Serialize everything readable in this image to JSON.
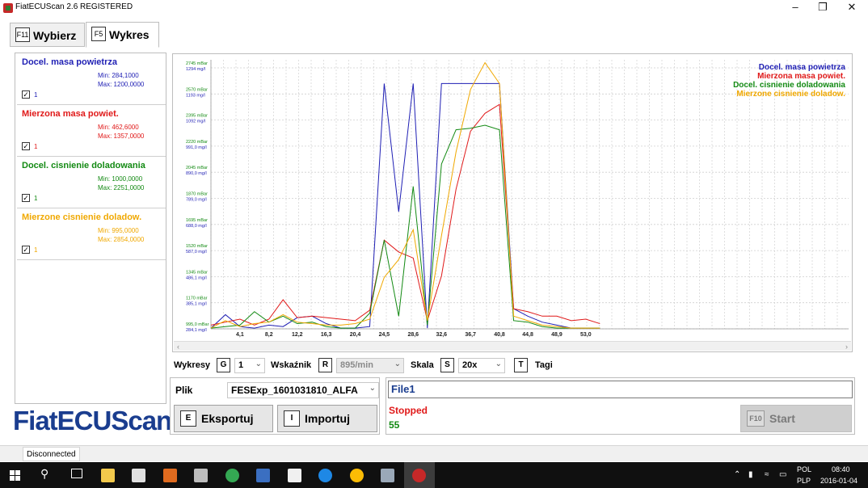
{
  "window": {
    "title": "FiatECUScan 2.6 REGISTERED"
  },
  "tabs": [
    {
      "key": "F11",
      "label": "Wybierz"
    },
    {
      "key": "F5",
      "label": "Wykres"
    }
  ],
  "series": [
    {
      "name": "Docel. masa powietrza",
      "min": "Min: 284,1000",
      "max": "Max: 1200,0000",
      "checked": "1",
      "color": "#1f1fb4"
    },
    {
      "name": "Mierzona masa powiet.",
      "min": "Min: 462,6000",
      "max": "Max: 1357,0000",
      "checked": "1",
      "color": "#e01919"
    },
    {
      "name": "Docel. cisnienie doladowania",
      "min": "Min: 1000,0000",
      "max": "Max: 2251,0000",
      "checked": "1",
      "color": "#138a13"
    },
    {
      "name": "Mierzone cisnienie doladow.",
      "min": "Min: 995,0000",
      "max": "Max: 2854,0000",
      "checked": "1",
      "color": "#f0a800"
    }
  ],
  "logo": "FiatECUScan",
  "chart_data": {
    "type": "line",
    "x": [
      0,
      2.05,
      4.1,
      6.15,
      8.2,
      10.2,
      12.2,
      14.3,
      16.3,
      18.35,
      20.4,
      22.45,
      24.5,
      26.55,
      28.6,
      30.6,
      32.6,
      34.65,
      36.7,
      38.75,
      40.8,
      42.8,
      44.8,
      46.85,
      48.9,
      50.95,
      53.0,
      55.0
    ],
    "x_ticks": [
      "4,1",
      "8,2",
      "12,2",
      "16,3",
      "20,4",
      "24,5",
      "28,6",
      "32,6",
      "36,7",
      "40,8",
      "44,8",
      "48,9",
      "53,0"
    ],
    "y_ticks": [
      {
        "bar": "995,0 mBar",
        "mg": "284,1 mg/l"
      },
      {
        "bar": "1170 mBar",
        "mg": "385,1 mg/l"
      },
      {
        "bar": "1345 mBar",
        "mg": "486,1 mg/l"
      },
      {
        "bar": "1520 mBar",
        "mg": "587,0 mg/l"
      },
      {
        "bar": "1695 mBar",
        "mg": "688,0 mg/l"
      },
      {
        "bar": "1870 mBar",
        "mg": "789,0 mg/l"
      },
      {
        "bar": "2045 mBar",
        "mg": "890,0 mg/l"
      },
      {
        "bar": "2220 mBar",
        "mg": "991,0 mg/l"
      },
      {
        "bar": "2395 mBar",
        "mg": "1092 mg/l"
      },
      {
        "bar": "2570 mBar",
        "mg": "1193 mg/l"
      },
      {
        "bar": "2745 mBar",
        "mg": "1294 mg/l"
      }
    ],
    "ylim": [
      995,
      2745
    ],
    "grid": true,
    "legend": "top-right",
    "series": [
      {
        "name": "Docel. masa powietrza",
        "color": "#1f1fb4",
        "values": [
          1000,
          1090,
          1010,
          1000,
          1020,
          1010,
          1070,
          1080,
          1030,
          1000,
          1000,
          1010,
          2640,
          1780,
          2640,
          1000,
          2640,
          2640,
          2640,
          2640,
          2640,
          1130,
          1080,
          1040,
          1020,
          1000,
          1000,
          1000
        ]
      },
      {
        "name": "Mierzona masa powiet.",
        "color": "#e01919",
        "values": [
          1020,
          1040,
          1060,
          1020,
          1060,
          1190,
          1070,
          1080,
          1070,
          1060,
          1050,
          1120,
          1590,
          1510,
          1470,
          1050,
          1350,
          1930,
          2320,
          2440,
          2500,
          1130,
          1110,
          1080,
          1080,
          1050,
          1060,
          1030
        ]
      },
      {
        "name": "Docel. cisnienie doladowania",
        "color": "#138a13",
        "values": [
          1000,
          1010,
          1020,
          1110,
          1040,
          1080,
          1030,
          1040,
          1010,
          1000,
          1000,
          1100,
          1590,
          1080,
          1950,
          1020,
          2100,
          2330,
          2340,
          2360,
          2330,
          1050,
          1040,
          1010,
          1000,
          1000,
          1000,
          1000
        ]
      },
      {
        "name": "Mierzone cisnienie doladow.",
        "color": "#f0a800",
        "values": [
          1000,
          1050,
          1010,
          1030,
          1040,
          1090,
          1040,
          1030,
          1020,
          1020,
          1030,
          1060,
          1340,
          1460,
          1660,
          1050,
          1620,
          2180,
          2600,
          2780,
          2640,
          1080,
          1050,
          1020,
          1010,
          1000,
          1000,
          1000
        ]
      }
    ]
  },
  "controls": {
    "wykresy_label": "Wykresy",
    "wykresy_key": "G",
    "wykresy_value": "1",
    "wskaznik_label": "Wskaźnik",
    "wskaznik_key": "R",
    "wskaznik_value": "895/min",
    "skala_label": "Skala",
    "skala_key": "S",
    "skala_value": "20x",
    "tagi_key": "T",
    "tagi_label": "Tagi"
  },
  "file": {
    "label": "Plik",
    "value": "FESExp_1601031810_ALFA",
    "export_key": "E",
    "export_label": "Eksportuj",
    "import_key": "I",
    "import_label": "Importuj"
  },
  "run": {
    "file_name": "File1",
    "status": "Stopped",
    "count": "55",
    "start_key": "F10",
    "start_label": "Start"
  },
  "statusbar": {
    "connection": "Disconnected"
  },
  "taskbar": {
    "lang1": "POL",
    "lang2": "PLP",
    "time": "08:40",
    "date": "2016-01-04"
  }
}
